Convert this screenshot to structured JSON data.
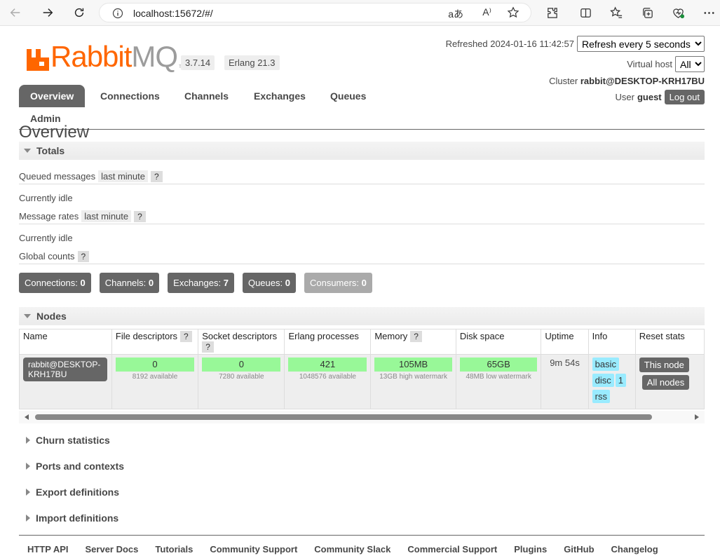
{
  "browser": {
    "url": "localhost:15672/#/",
    "read_aloud_label": "aあ",
    "text_size_label": "A⁾"
  },
  "header": {
    "brand": {
      "rabbit": "Rabbit",
      "mq": "MQ",
      "tm": "TM"
    },
    "version": "3.7.14",
    "erlang": "Erlang 21.3",
    "refreshed_label": "Refreshed 2024-01-16 11:42:57",
    "refresh_select": "Refresh every 5 seconds",
    "vhost_label": "Virtual host",
    "vhost_select": "All",
    "cluster_label": "Cluster",
    "cluster_name": "rabbit@DESKTOP-KRH17BU",
    "user_label": "User",
    "user_name": "guest",
    "logout": "Log out"
  },
  "tabs": [
    "Overview",
    "Connections",
    "Channels",
    "Exchanges",
    "Queues",
    "Admin"
  ],
  "page_title": "Overview",
  "totals": {
    "heading": "Totals",
    "queued_label": "Queued messages",
    "queued_range": "last minute",
    "help": "?",
    "idle1": "Currently idle",
    "rates_label": "Message rates",
    "rates_range": "last minute",
    "idle2": "Currently idle",
    "global_label": "Global counts",
    "counts": [
      {
        "label": "Connections:",
        "value": "0"
      },
      {
        "label": "Channels:",
        "value": "0"
      },
      {
        "label": "Exchanges:",
        "value": "7"
      },
      {
        "label": "Queues:",
        "value": "0"
      },
      {
        "label": "Consumers:",
        "value": "0"
      }
    ]
  },
  "nodes": {
    "heading": "Nodes",
    "columns": [
      "Name",
      "File descriptors",
      "Socket descriptors",
      "Erlang processes",
      "Memory",
      "Disk space",
      "Uptime",
      "Info",
      "Reset stats"
    ],
    "row": {
      "name": "rabbit@DESKTOP-KRH17BU",
      "fd": "0",
      "fd_sub": "8192 available",
      "sd": "0",
      "sd_sub": "7280 available",
      "ep": "421",
      "ep_sub": "1048576 available",
      "mem": "105MB",
      "mem_sub": "13GB high watermark",
      "disk": "65GB",
      "disk_sub": "48MB low watermark",
      "uptime": "9m 54s",
      "info": [
        "basic",
        "disc",
        "1",
        "rss"
      ],
      "reset": [
        "This node",
        "All nodes"
      ]
    }
  },
  "folds": [
    "Churn statistics",
    "Ports and contexts",
    "Export definitions",
    "Import definitions"
  ],
  "footer": [
    "HTTP API",
    "Server Docs",
    "Tutorials",
    "Community Support",
    "Community Slack",
    "Commercial Support",
    "Plugins",
    "GitHub",
    "Changelog"
  ],
  "colors": {
    "brand_orange": "#ff6600",
    "tab_active": "#666666",
    "gauge_green": "#98f898",
    "info_tag": "#99ebff"
  }
}
